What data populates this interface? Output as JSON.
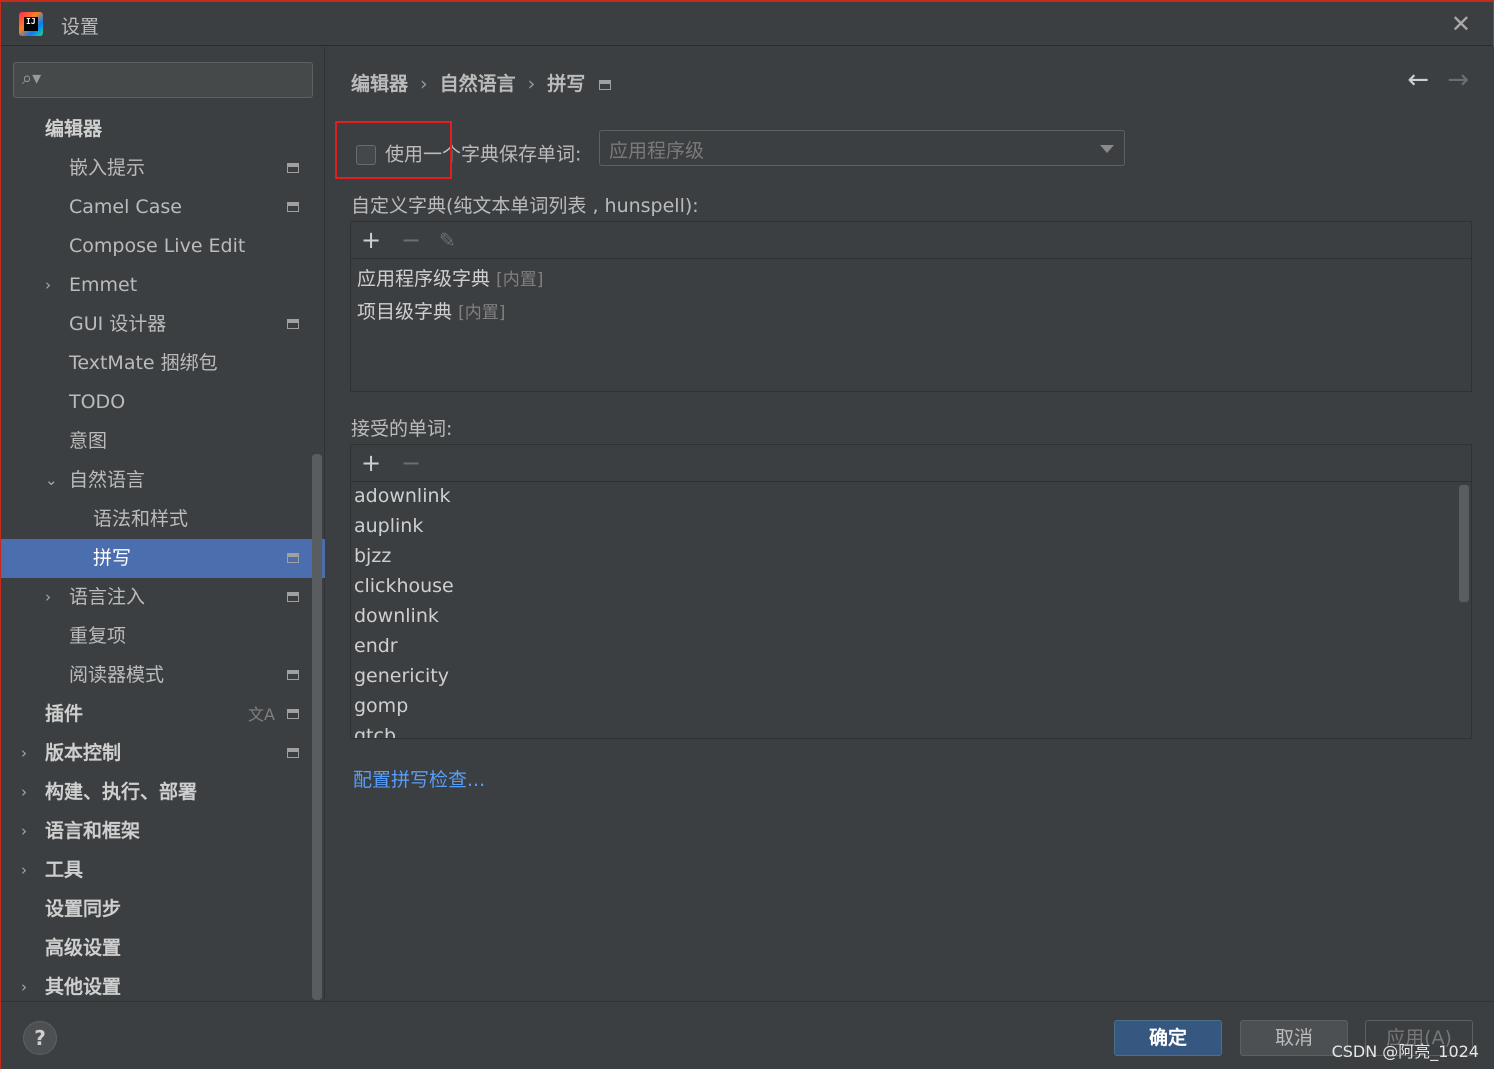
{
  "window": {
    "title": "设置"
  },
  "sidebar": {
    "search_placeholder": "",
    "items": [
      {
        "label": "编辑器",
        "bold": true,
        "chevron": "",
        "badge": false
      },
      {
        "label": "嵌入提示",
        "badge": true
      },
      {
        "label": "Camel Case",
        "badge": true
      },
      {
        "label": "Compose Live Edit",
        "badge": false
      },
      {
        "label": "Emmet",
        "chevron": "›",
        "badge": false
      },
      {
        "label": "GUI 设计器",
        "badge": true
      },
      {
        "label": "TextMate 捆绑包",
        "badge": false
      },
      {
        "label": "TODO",
        "badge": false
      },
      {
        "label": "意图",
        "badge": false
      },
      {
        "label": "自然语言",
        "chevron": "⌄",
        "badge": false
      },
      {
        "label": "语法和样式",
        "badge": false
      },
      {
        "label": "拼写",
        "badge": true,
        "selected": true
      },
      {
        "label": "语言注入",
        "chevron": "›",
        "badge": true
      },
      {
        "label": "重复项",
        "badge": false
      },
      {
        "label": "阅读器模式",
        "badge": true
      },
      {
        "label": "插件",
        "bold": true,
        "badge": true,
        "translate_icon": true
      },
      {
        "label": "版本控制",
        "bold": true,
        "chevron": "›",
        "badge": true
      },
      {
        "label": "构建、执行、部署",
        "bold": true,
        "chevron": "›",
        "badge": false
      },
      {
        "label": "语言和框架",
        "bold": true,
        "chevron": "›",
        "badge": false
      },
      {
        "label": "工具",
        "bold": true,
        "chevron": "›",
        "badge": false
      },
      {
        "label": "设置同步",
        "bold": true,
        "badge": false
      },
      {
        "label": "高级设置",
        "bold": true,
        "badge": false
      },
      {
        "label": "其他设置",
        "bold": true,
        "chevron": "›",
        "badge": false
      }
    ],
    "translate_icon_glyph": "文A"
  },
  "breadcrumb": {
    "items": [
      "编辑器",
      "自然语言",
      "拼写"
    ]
  },
  "spelling": {
    "use_single_dict_label": "使用一个字典保存单词:",
    "dict_level_value": "应用程序级",
    "custom_dict_label": "自定义字典(纯文本单词列表 , hunspell):",
    "dictionaries": [
      {
        "name": "应用程序级字典",
        "tag": "[内置]"
      },
      {
        "name": "项目级字典",
        "tag": "[内置]"
      }
    ],
    "accepted_words_label": "接受的单词:",
    "accepted_words": [
      "adownlink",
      "auplink",
      "bjzz",
      "clickhouse",
      "downlink",
      "endr",
      "genericity",
      "gomp",
      "gtcb"
    ],
    "configure_link": "配置拼写检查..."
  },
  "buttons": {
    "ok": "确定",
    "cancel": "取消",
    "apply": "应用(A)",
    "help": "?"
  },
  "watermark": "CSDN @阿亮_1024"
}
